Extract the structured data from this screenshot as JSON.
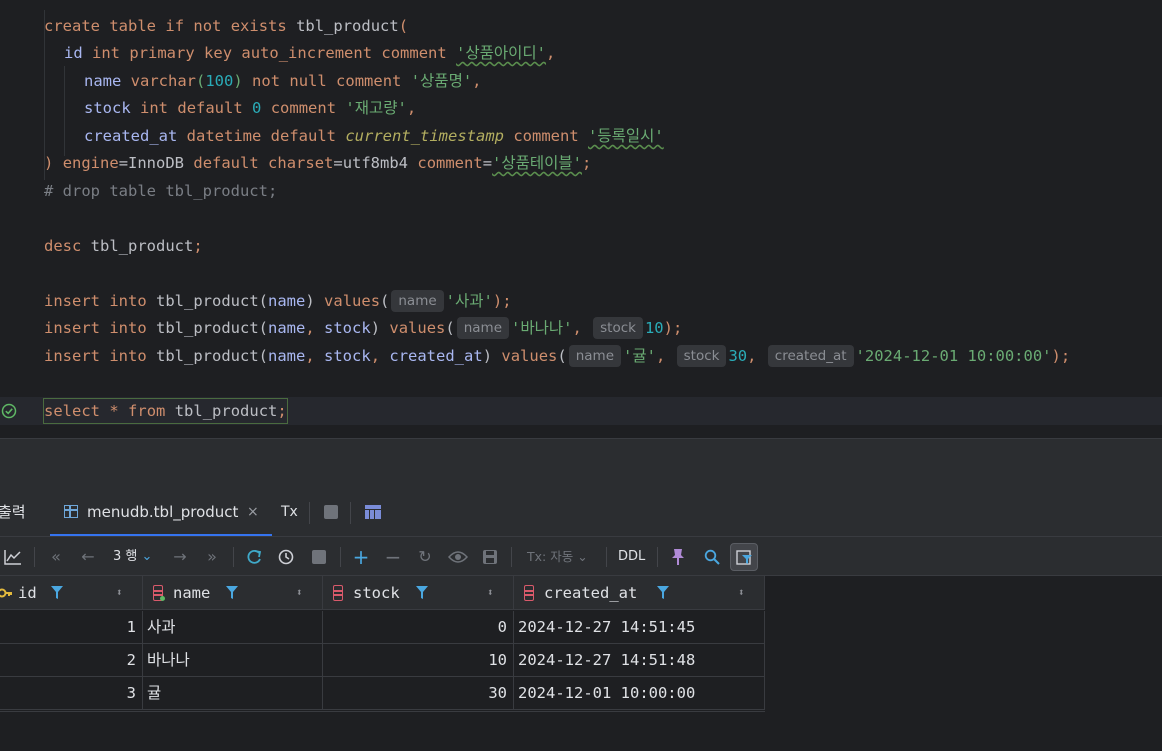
{
  "editor": {
    "lines": {
      "l1": {
        "create": "create",
        "table": "table",
        "if": "if",
        "not": "not",
        "exists": "exists",
        "name": "tbl_product",
        "paren": "("
      },
      "l2": {
        "col": "id",
        "type": "int",
        "primary": "primary",
        "key": "key",
        "ai": "auto_increment",
        "comment": "comment",
        "str": "'상품아이디'",
        "tail": ","
      },
      "l3": {
        "col": "name",
        "type": "varchar",
        "lp": "(",
        "num": "100",
        "rp": ")",
        "not": "not",
        "null": "null",
        "comment": "comment",
        "str": "'상품명'",
        "tail": ","
      },
      "l4": {
        "col": "stock",
        "type": "int",
        "default": "default",
        "num": "0",
        "comment": "comment",
        "str": "'재고량'",
        "tail": ","
      },
      "l5": {
        "col": "created_at",
        "type": "datetime",
        "default": "default",
        "fn": "current_timestamp",
        "comment": "comment",
        "str": "'등록일시'"
      },
      "l6": {
        "rp": ")",
        "engine": "engine",
        "eq1": "=InnoDB",
        "default": "default",
        "charset": "charset",
        "eq2": "=utf8mb4",
        "comment": "comment",
        "eq3": "=",
        "str": "'상품테이블'",
        "semi": ";"
      },
      "l7": {
        "comment": "# drop table tbl_product;"
      },
      "l8": {
        "desc": "desc",
        "name": "tbl_product",
        "semi": ";"
      },
      "l9": {
        "insert": "insert",
        "into": "into",
        "table": "tbl_product",
        "lp": "(",
        "c1": "name",
        "rp": ")",
        "values": "values",
        "vlp": "(",
        "h1": "name",
        "v1": "'사과'",
        "end": ");"
      },
      "l10": {
        "insert": "insert",
        "into": "into",
        "table": "tbl_product",
        "lp": "(",
        "c1": "name",
        "comma1": ", ",
        "c2": "stock",
        "rp": ")",
        "values": "values",
        "vlp": "(",
        "h1": "name",
        "v1": "'바나나'",
        "comma2": ", ",
        "h2": "stock",
        "v2": "10",
        "end": ");"
      },
      "l11": {
        "insert": "insert",
        "into": "into",
        "table": "tbl_product",
        "lp": "(",
        "c1": "name",
        "comma1": ", ",
        "c2": "stock",
        "comma2": ", ",
        "c3": "created_at",
        "rp": ")",
        "values": "values",
        "vlp": "(",
        "h1": "name",
        "v1": "'귤'",
        "comma3": ", ",
        "h2": "stock",
        "v2": "30",
        "comma4": ", ",
        "h3": "created_at",
        "v3": "'2024-12-01 10:00:00'",
        "end": ");"
      },
      "l12": {
        "select": "select",
        "star": "*",
        "from": "from",
        "name": "tbl_product",
        "semi": ";"
      }
    }
  },
  "tool_tabs": {
    "output": "출력",
    "product": "menudb.tbl_product",
    "close": "×",
    "tx": "Tx"
  },
  "grid_toolbar": {
    "rows": "3 행",
    "tx_mode": "Tx: 자동",
    "ddl": "DDL"
  },
  "table": {
    "columns": [
      "id",
      "name",
      "stock",
      "created_at"
    ],
    "rows": [
      [
        "1",
        "사과",
        "0",
        "2024-12-27 14:51:45"
      ],
      [
        "2",
        "바나나",
        "10",
        "2024-12-27 14:51:48"
      ],
      [
        "3",
        "귤",
        "30",
        "2024-12-01 10:00:00"
      ]
    ]
  },
  "colors": {
    "keyword": "#cf8e6d",
    "string": "#6aab73",
    "number": "#2aacb8",
    "comment": "#7a7e85",
    "accent": "#3574f0"
  }
}
